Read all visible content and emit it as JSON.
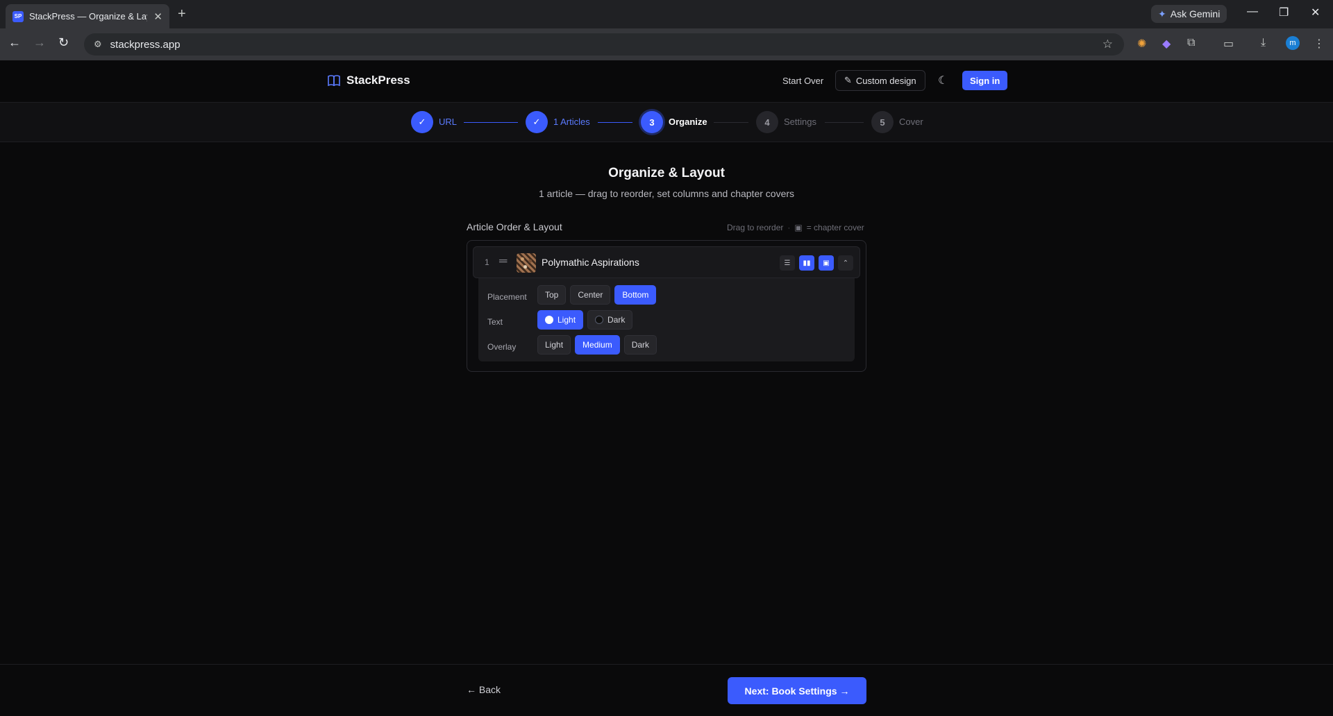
{
  "browser": {
    "tab_title": "StackPress — Organize & Layout",
    "favicon_text": "SP",
    "url": "stackpress.app",
    "gemini_label": "Ask Gemini",
    "profile_initial": "m"
  },
  "header": {
    "brand": "StackPress",
    "start_over": "Start Over",
    "custom_design": "Custom design",
    "sign_in": "Sign in"
  },
  "steps": [
    {
      "number": "1",
      "label": "URL",
      "state": "done"
    },
    {
      "number": "2",
      "label": "1 Articles",
      "state": "done"
    },
    {
      "number": "3",
      "label": "Organize",
      "state": "active"
    },
    {
      "number": "4",
      "label": "Settings",
      "state": "todo"
    },
    {
      "number": "5",
      "label": "Cover",
      "state": "todo"
    }
  ],
  "main": {
    "title": "Organize & Layout",
    "subtitle": "1 article — drag to reorder, set columns and chapter covers",
    "section_title": "Article Order & Layout",
    "hint_drag": "Drag to reorder",
    "hint_cover": "= chapter cover"
  },
  "articles": [
    {
      "index": "1",
      "title": "Polymathic Aspirations"
    }
  ],
  "cover_options": {
    "placement_label": "Placement",
    "placement": [
      "Top",
      "Center",
      "Bottom"
    ],
    "placement_selected": "Bottom",
    "text_label": "Text",
    "text": [
      "Light",
      "Dark"
    ],
    "text_selected": "Light",
    "overlay_label": "Overlay",
    "overlay": [
      "Light",
      "Medium",
      "Dark"
    ],
    "overlay_selected": "Medium"
  },
  "footer": {
    "back": "← Back",
    "next": "Next: Book Settings →"
  },
  "colors": {
    "accent": "#3b5bfd",
    "background": "#0a0a0b"
  }
}
